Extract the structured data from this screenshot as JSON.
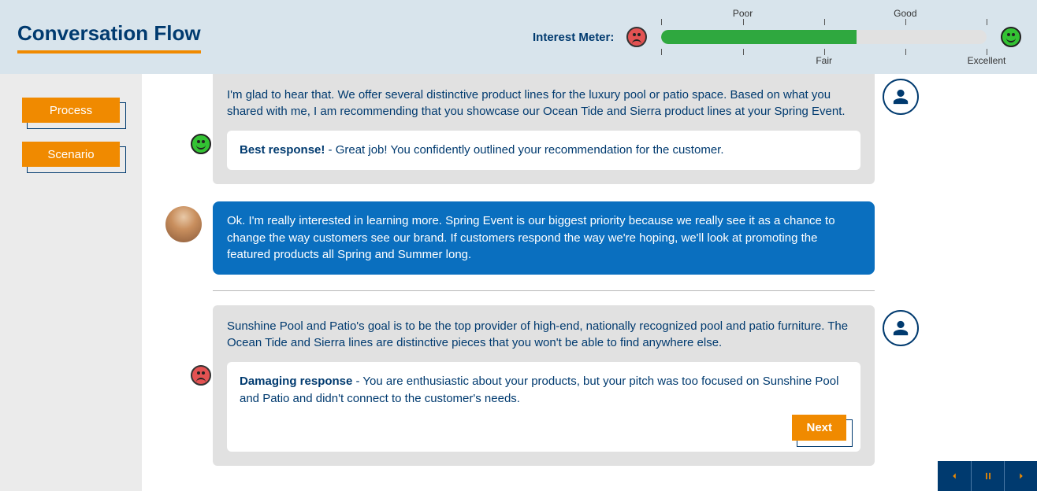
{
  "header": {
    "title": "Conversation Flow",
    "meter_label": "Interest Meter:",
    "labels": {
      "poor": "Poor",
      "fair": "Fair",
      "good": "Good",
      "excellent": "Excellent"
    },
    "fill_percent": 60
  },
  "sidebar": {
    "process": "Process",
    "scenario": "Scenario"
  },
  "chat": {
    "block1": {
      "text": "I'm glad to hear that. We offer several distinctive product lines for the luxury pool or patio space. Based on what you shared with me, I am recommending that you showcase our Ocean Tide and Sierra product lines at your Spring Event.",
      "feedback_label": "Best response!",
      "feedback_text": " - Great job! You confidently outlined your recommendation for the customer."
    },
    "customer": {
      "text": "Ok. I'm really interested in learning more. Spring Event is our biggest priority because we really see it as a chance to change the way customers see our brand. If customers respond the way we're hoping, we'll look at promoting the featured products all Spring and Summer long."
    },
    "block2": {
      "text": "Sunshine Pool and Patio's goal is to be the top provider of high-end, nationally recognized pool and patio furniture. The Ocean Tide and Sierra lines are distinctive pieces that you won't be able to find anywhere else.",
      "feedback_label": "Damaging response",
      "feedback_text": " - You are enthusiastic about your products, but your pitch was too focused on Sunshine Pool and Patio and didn't connect to the customer's needs.",
      "next": "Next"
    }
  }
}
